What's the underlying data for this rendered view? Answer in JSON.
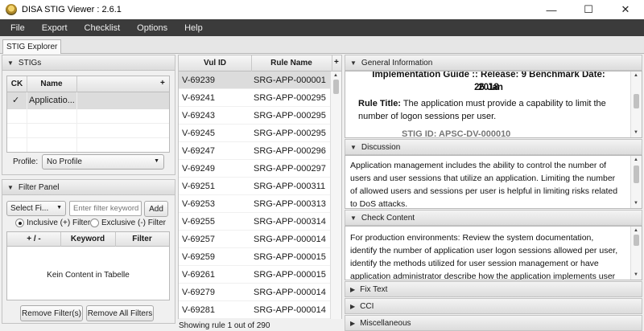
{
  "window": {
    "title": "DISA STIG Viewer : 2.6.1"
  },
  "menu": [
    "File",
    "Export",
    "Checklist",
    "Options",
    "Help"
  ],
  "tab": "STIG Explorer",
  "stigs": {
    "header": "STIGs",
    "columns": [
      "CK",
      "Name"
    ],
    "plus": "+",
    "rows": [
      {
        "check": "✓",
        "name": "Applicatio..."
      }
    ],
    "profile_label": "Profile:",
    "profile_value": "No Profile"
  },
  "filter": {
    "header": "Filter Panel",
    "select": "Select Fi...",
    "placeholder": "Enter filter keyword",
    "add": "Add",
    "inclusive": "Inclusive (+) Filter",
    "exclusive": "Exclusive (-) Filter",
    "columns": [
      "+ / -",
      "Keyword",
      "Filter"
    ],
    "empty": "Kein Content in Tabelle",
    "remove": "Remove Filter(s)",
    "remove_all": "Remove All Filters"
  },
  "rules": {
    "columns": [
      "Vul ID",
      "Rule Name"
    ],
    "plus": "+",
    "rows": [
      [
        "V-69239",
        "SRG-APP-000001"
      ],
      [
        "V-69241",
        "SRG-APP-000295"
      ],
      [
        "V-69243",
        "SRG-APP-000295"
      ],
      [
        "V-69245",
        "SRG-APP-000295"
      ],
      [
        "V-69247",
        "SRG-APP-000296"
      ],
      [
        "V-69249",
        "SRG-APP-000297"
      ],
      [
        "V-69251",
        "SRG-APP-000311"
      ],
      [
        "V-69253",
        "SRG-APP-000313"
      ],
      [
        "V-69255",
        "SRG-APP-000314"
      ],
      [
        "V-69257",
        "SRG-APP-000014"
      ],
      [
        "V-69259",
        "SRG-APP-000015"
      ],
      [
        "V-69261",
        "SRG-APP-000015"
      ],
      [
        "V-69279",
        "SRG-APP-000014"
      ],
      [
        "V-69281",
        "SRG-APP-000014"
      ]
    ],
    "status": "Showing rule 1 out of 290"
  },
  "details": {
    "general": {
      "header": "General Information",
      "line1": "Implementation Guide :: Release: 9 Benchmark Date: 26 Jan",
      "line2": "2018",
      "rule_title_label": "Rule Title:",
      "rule_title_text": " The application must provide a capability to limit the",
      "rule_title_text2": "number of logon sessions per user.",
      "cut": "STIG ID:  APSC-DV-000010"
    },
    "discussion": {
      "header": "Discussion",
      "lines": [
        "Application management includes the ability to control the number of",
        "users and user sessions that utilize an application. Limiting the number",
        "of allowed users and sessions per user is helpful in limiting risks related",
        "to DoS attacks."
      ]
    },
    "check": {
      "header": "Check Content",
      "lines": [
        "For production environments: Review the system documentation,",
        "identify the number of application user logon sessions allowed per user,",
        "identify the methods utilized for user session management or have",
        "application administrator describe how the application implements user"
      ]
    },
    "fix": "Fix Text",
    "cci": "CCI",
    "misc": "Miscellaneous"
  },
  "colors": {
    "menubar": "#3b3b3b",
    "selected_row": "#dcdcdc"
  }
}
